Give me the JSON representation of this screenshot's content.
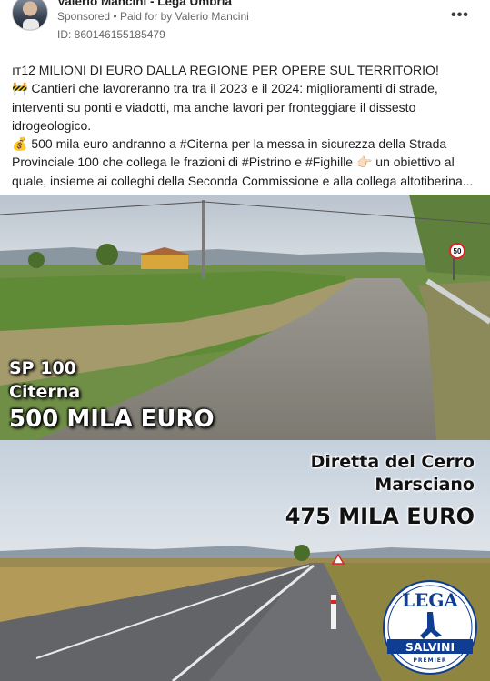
{
  "post": {
    "author": "Valerio Mancini - Lega Umbria",
    "sponsored": "Sponsored",
    "separator": "•",
    "paid_for": "Paid for by Valerio Mancini",
    "ad_id": "ID: 860146155185479",
    "more_icon": "more-options-icon",
    "text": {
      "line1": "12 MILIONI DI EURO DALLA REGIONE PER OPERE SUL TERRITORIO!",
      "line1_emoji": "ıт",
      "line2_emoji": "🚧",
      "line2": " Cantieri che lavoreranno tra tra il 2023 e il 2024: miglioramenti di strade, interventi su ponti e viadotti, ma anche lavori per fronteggiare il dissesto idrogeologico.",
      "line3_emoji": "💰",
      "line3": " 500 mila euro andranno a #Citerna per la messa in sicurezza della Strada Provinciale 100 che collega le frazioni di #Pistrino e #Fighille ",
      "line3_emoji2": "👉🏻",
      "line3_end": " un obiettivo al quale, insieme ai colleghi della Seconda Commissione e alla collega altotiberina..."
    }
  },
  "image_top": {
    "caption_l1": "SP 100",
    "caption_l2": "Citerna",
    "caption_l3": "500 MILA EURO",
    "sign_text": "50"
  },
  "image_bottom": {
    "caption_l1": "Diretta del Cerro",
    "caption_l2": "Marsciano",
    "caption_l3": "475 MILA EURO"
  },
  "logo": {
    "top": "LEGA",
    "band": "SALVINI",
    "sub": "PREMIER"
  },
  "colors": {
    "lega_blue": "#0f3d91",
    "sky_top": "#c8d2dc",
    "sky_bottom": "#cfd6df"
  }
}
